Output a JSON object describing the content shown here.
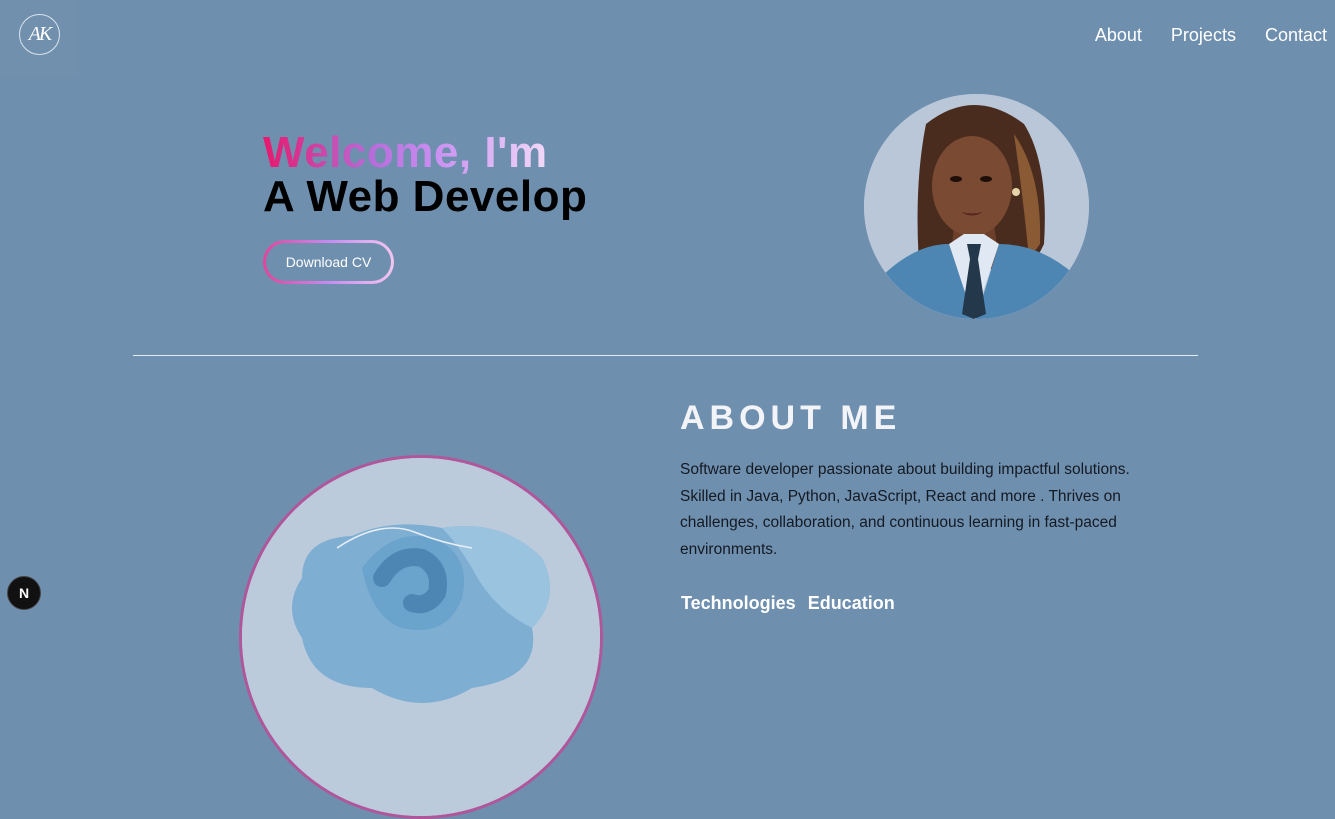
{
  "logo": {
    "text": "AK"
  },
  "nav": {
    "about": "About",
    "projects": "Projects",
    "contact": "Contact"
  },
  "hero": {
    "line1": "Welcome, I'm",
    "line2": "A Web Develop",
    "cv_button": "Download CV"
  },
  "about": {
    "title": "ABOUT ME",
    "description": "Software developer passionate about building impactful solutions. Skilled in Java, Python, JavaScript, React and more . Thrives on challenges, collaboration, and continuous learning in fast-paced environments.",
    "tabs": [
      "Technologies",
      "Education"
    ]
  },
  "dev_badge": {
    "text": "N"
  },
  "colors": {
    "background": "#6f8faf",
    "accent_pink": "#e8186d",
    "accent_purple": "#c98ff2",
    "circle_border": "#b0569b"
  },
  "icons": {
    "logo": "monogram-logo-icon",
    "dev_badge": "nextjs-icon"
  }
}
